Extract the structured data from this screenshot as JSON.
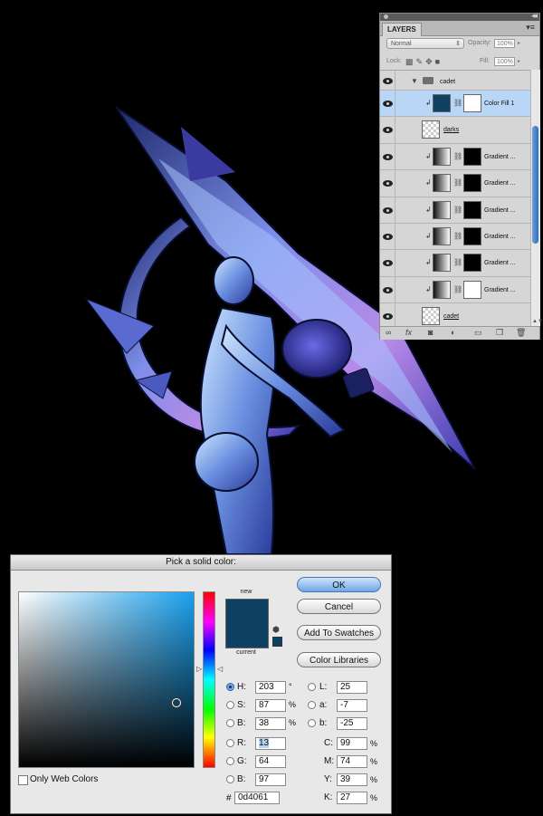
{
  "layers_panel": {
    "tab": "LAYERS",
    "blend_mode": "Normal",
    "opacity_label": "Opacity:",
    "opacity_value": "100%",
    "lock_label": "Lock:",
    "fill_label": "Fill:",
    "fill_value": "100%",
    "group_name": "cadet",
    "layers": [
      {
        "name": "Color Fill 1",
        "thumb": "fill",
        "mask": "white",
        "selected": true,
        "clipped": true,
        "thumb_color": "#0d4061"
      },
      {
        "name": "darks",
        "thumb": "transparent",
        "mask": "none",
        "selected": false,
        "clipped": false
      },
      {
        "name": "Gradient ...",
        "thumb": "gradient",
        "mask": "black",
        "selected": false,
        "clipped": true
      },
      {
        "name": "Gradient ...",
        "thumb": "gradient",
        "mask": "black",
        "selected": false,
        "clipped": true
      },
      {
        "name": "Gradient ...",
        "thumb": "gradient",
        "mask": "black",
        "selected": false,
        "clipped": true
      },
      {
        "name": "Gradient ...",
        "thumb": "gradient",
        "mask": "black",
        "selected": false,
        "clipped": true
      },
      {
        "name": "Gradient ...",
        "thumb": "gradient",
        "mask": "black",
        "selected": false,
        "clipped": true
      },
      {
        "name": "Gradient ...",
        "thumb": "gradient",
        "mask": "white",
        "selected": false,
        "clipped": true
      },
      {
        "name": "cadet",
        "thumb": "transparent",
        "mask": "none",
        "selected": false,
        "clipped": false
      }
    ],
    "bottom_icons": [
      "link-icon",
      "fx-icon",
      "mask-icon",
      "adjustment-icon",
      "folder-icon",
      "new-layer-icon",
      "trash-icon"
    ]
  },
  "picker": {
    "title": "Pick a solid color:",
    "new_label": "new",
    "current_label": "current",
    "new_color": "#0d4061",
    "current_color": "#0d4061",
    "ok": "OK",
    "cancel": "Cancel",
    "add_swatches": "Add To Swatches",
    "color_libraries": "Color Libraries",
    "only_web": "Only Web Colors",
    "hsb": {
      "h_label": "H:",
      "h": "203",
      "h_unit": "°",
      "s_label": "S:",
      "s": "87",
      "s_unit": "%",
      "b_label": "B:",
      "b": "38",
      "b_unit": "%"
    },
    "rgb": {
      "r_label": "R:",
      "r": "13",
      "g_label": "G:",
      "g": "64",
      "b_label": "B:",
      "b": "97"
    },
    "lab": {
      "l_label": "L:",
      "l": "25",
      "a_label": "a:",
      "a": "-7",
      "b_label": "b:",
      "b": "-25"
    },
    "cmyk": {
      "c_label": "C:",
      "c": "99",
      "m_label": "M:",
      "m": "74",
      "y_label": "Y:",
      "y": "39",
      "k_label": "K:",
      "k": "27",
      "unit": "%"
    },
    "hex_label": "#",
    "hex": "0d4061",
    "field_hue_color": "#1aa0ee"
  },
  "colors": {
    "selection": "#b9d6f7",
    "background": "#000000"
  }
}
